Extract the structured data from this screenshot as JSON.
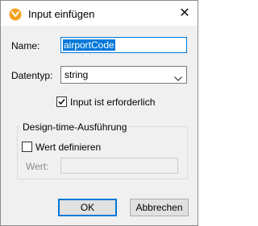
{
  "window": {
    "title": "Input einfügen",
    "close_glyph": "✕",
    "icon": "mapforce-app-icon"
  },
  "form": {
    "name_label": "Name:",
    "name_value": "airportCode",
    "datatype_label": "Datentyp:",
    "datatype_value": "string",
    "required_label": "Input ist erforderlich",
    "required_checked": true
  },
  "design_time": {
    "group_title": "Design-time-Ausführung",
    "define_value_label": "Wert definieren",
    "define_value_checked": false,
    "value_label": "Wert:",
    "value": ""
  },
  "buttons": {
    "ok_label": "OK",
    "cancel_label": "Abbrechen"
  },
  "colors": {
    "accent": "#0078d7",
    "icon_orange": "#f4a21c"
  }
}
